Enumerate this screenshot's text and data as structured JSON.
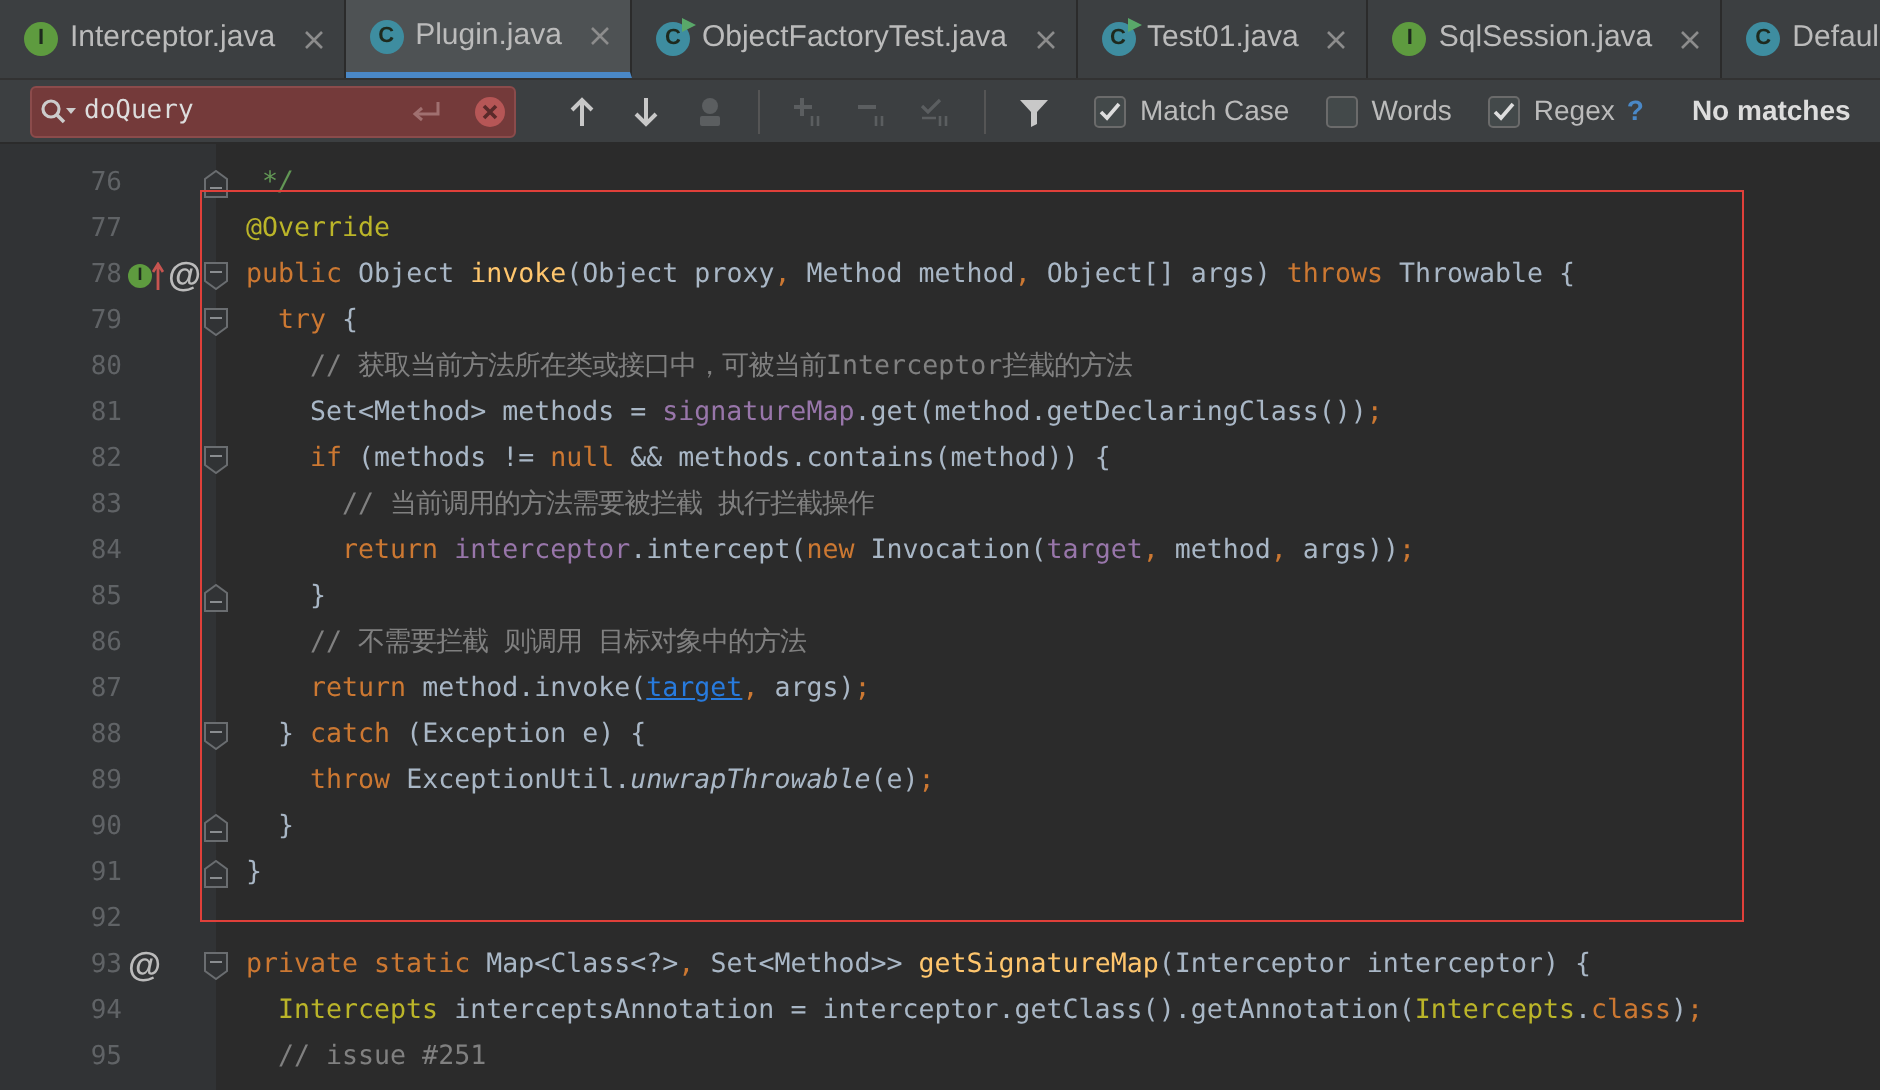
{
  "tabs": [
    {
      "label": "Interceptor.java",
      "kind": "interface",
      "icon_letter": "I",
      "selected": false,
      "closable": true
    },
    {
      "label": "Plugin.java",
      "kind": "class",
      "icon_letter": "C",
      "selected": true,
      "closable": true
    },
    {
      "label": "ObjectFactoryTest.java",
      "kind": "test",
      "icon_letter": "C",
      "selected": false,
      "closable": true
    },
    {
      "label": "Test01.java",
      "kind": "test",
      "icon_letter": "C",
      "selected": false,
      "closable": true
    },
    {
      "label": "SqlSession.java",
      "kind": "interface",
      "icon_letter": "I",
      "selected": false,
      "closable": true
    },
    {
      "label": "Defaul",
      "kind": "class",
      "icon_letter": "C",
      "selected": false,
      "closable": false
    }
  ],
  "find_bar": {
    "search": {
      "value": "doQuery",
      "error": true
    },
    "tools": [
      {
        "kind": "up",
        "disabled": false
      },
      {
        "kind": "down",
        "disabled": false
      },
      {
        "kind": "findall",
        "disabled": true
      },
      {
        "kind": "separator"
      },
      {
        "kind": "add",
        "disabled": true
      },
      {
        "kind": "remove",
        "disabled": true
      },
      {
        "kind": "selectall",
        "disabled": true
      },
      {
        "kind": "separator"
      },
      {
        "kind": "filter",
        "disabled": false
      }
    ],
    "options": [
      {
        "label": "Match Case",
        "checked": true
      },
      {
        "label": "Words",
        "checked": false
      },
      {
        "label": "Regex",
        "checked": true
      }
    ],
    "help": "?",
    "status": "No matches"
  },
  "editor": {
    "before": [
      {
        "number": "76",
        "fold_end": true,
        "tokens": [
          {
            "text": " */",
            "kind": "doc"
          }
        ]
      }
    ],
    "highlighted": [
      {
        "number": "77",
        "tokens": [
          {
            "text": "@Override",
            "kind": "ann"
          }
        ]
      },
      {
        "number": "78",
        "fold_start": true,
        "gutter": [
          {
            "kind": "implements",
            "letter": "I"
          },
          {
            "kind": "symbol",
            "text": "@"
          }
        ],
        "tokens": [
          {
            "text": "public ",
            "kind": "kw"
          },
          {
            "text": "Object ",
            "kind": "p"
          },
          {
            "text": "invoke",
            "kind": "decl"
          },
          {
            "text": "(Object proxy",
            "kind": "p"
          },
          {
            "text": ", ",
            "kind": "kw"
          },
          {
            "text": "Method method",
            "kind": "p"
          },
          {
            "text": ", ",
            "kind": "kw"
          },
          {
            "text": "Object[] args) ",
            "kind": "p"
          },
          {
            "text": "throws ",
            "kind": "kw"
          },
          {
            "text": "Throwable {",
            "kind": "p"
          }
        ]
      },
      {
        "number": "79",
        "fold_start": true,
        "tokens": [
          {
            "text": "  try ",
            "kind": "kw"
          },
          {
            "text": "{",
            "kind": "p"
          }
        ]
      },
      {
        "number": "80",
        "tokens": [
          {
            "text": "    // 获取当前方法所在类或接口中，可被当前Interceptor拦截的方法",
            "kind": "cm"
          }
        ]
      },
      {
        "number": "81",
        "tokens": [
          {
            "text": "    Set<Method> methods = ",
            "kind": "p"
          },
          {
            "text": "signatureMap",
            "kind": "field"
          },
          {
            "text": ".get(method.getDeclaringClass())",
            "kind": "p"
          },
          {
            "text": ";",
            "kind": "kw"
          }
        ]
      },
      {
        "number": "82",
        "fold_start": true,
        "tokens": [
          {
            "text": "    if ",
            "kind": "kw"
          },
          {
            "text": "(methods != ",
            "kind": "p"
          },
          {
            "text": "null ",
            "kind": "kw"
          },
          {
            "text": "&& methods.contains(method)) {",
            "kind": "p"
          }
        ]
      },
      {
        "number": "83",
        "tokens": [
          {
            "text": "      // 当前调用的方法需要被拦截 执行拦截操作",
            "kind": "cm"
          }
        ]
      },
      {
        "number": "84",
        "tokens": [
          {
            "text": "      return ",
            "kind": "kw"
          },
          {
            "text": "interceptor",
            "kind": "field"
          },
          {
            "text": ".intercept(",
            "kind": "p"
          },
          {
            "text": "new ",
            "kind": "kw"
          },
          {
            "text": "Invocation(",
            "kind": "p"
          },
          {
            "text": "target",
            "kind": "field"
          },
          {
            "text": ", ",
            "kind": "kw"
          },
          {
            "text": "method",
            "kind": "p"
          },
          {
            "text": ", ",
            "kind": "kw"
          },
          {
            "text": "args))",
            "kind": "p"
          },
          {
            "text": ";",
            "kind": "kw"
          }
        ]
      },
      {
        "number": "85",
        "fold_end": true,
        "tokens": [
          {
            "text": "    }",
            "kind": "p"
          }
        ]
      },
      {
        "number": "86",
        "tokens": [
          {
            "text": "    // 不需要拦截 则调用 目标对象中的方法",
            "kind": "cm"
          }
        ]
      },
      {
        "number": "87",
        "tokens": [
          {
            "text": "    return ",
            "kind": "kw"
          },
          {
            "text": "method.invoke(",
            "kind": "p"
          },
          {
            "text": "target",
            "kind": "link"
          },
          {
            "text": ", ",
            "kind": "kw"
          },
          {
            "text": "args)",
            "kind": "p"
          },
          {
            "text": ";",
            "kind": "kw"
          }
        ]
      },
      {
        "number": "88",
        "fold_start": true,
        "tokens": [
          {
            "text": "  } ",
            "kind": "p"
          },
          {
            "text": "catch ",
            "kind": "kw"
          },
          {
            "text": "(Exception e) {",
            "kind": "p"
          }
        ]
      },
      {
        "number": "89",
        "tokens": [
          {
            "text": "    throw ",
            "kind": "kw"
          },
          {
            "text": "ExceptionUtil.",
            "kind": "p"
          },
          {
            "text": "unwrapThrowable",
            "kind": "italic"
          },
          {
            "text": "(e)",
            "kind": "p"
          },
          {
            "text": ";",
            "kind": "kw"
          }
        ]
      },
      {
        "number": "90",
        "fold_end": true,
        "tokens": [
          {
            "text": "  }",
            "kind": "p"
          }
        ]
      },
      {
        "number": "91",
        "fold_end": true,
        "tokens": [
          {
            "text": "}",
            "kind": "p"
          }
        ]
      },
      {
        "number": "92"
      }
    ],
    "after": [
      {
        "number": "93",
        "fold_start": true,
        "gutter": [
          {
            "kind": "symbol",
            "text": "@"
          }
        ],
        "tokens": [
          {
            "text": "private static ",
            "kind": "kw"
          },
          {
            "text": "Map<Class<?>",
            "kind": "p"
          },
          {
            "text": ", ",
            "kind": "kw"
          },
          {
            "text": "Set<Method>> ",
            "kind": "p"
          },
          {
            "text": "getSignatureMap",
            "kind": "decl"
          },
          {
            "text": "(Interceptor interceptor) {",
            "kind": "p"
          }
        ]
      },
      {
        "number": "94",
        "tokens": [
          {
            "text": "  Intercepts ",
            "kind": "ann"
          },
          {
            "text": "interceptsAnnotation = interceptor.getClass().getAnnotation(",
            "kind": "p"
          },
          {
            "text": "Intercepts",
            "kind": "ann"
          },
          {
            "text": ".",
            "kind": "p"
          },
          {
            "text": "class",
            "kind": "kw"
          },
          {
            "text": ")",
            "kind": "p"
          },
          {
            "text": ";",
            "kind": "kw"
          }
        ]
      },
      {
        "number": "95",
        "tokens": [
          {
            "text": "  // issue #251",
            "kind": "cm"
          }
        ]
      }
    ]
  }
}
